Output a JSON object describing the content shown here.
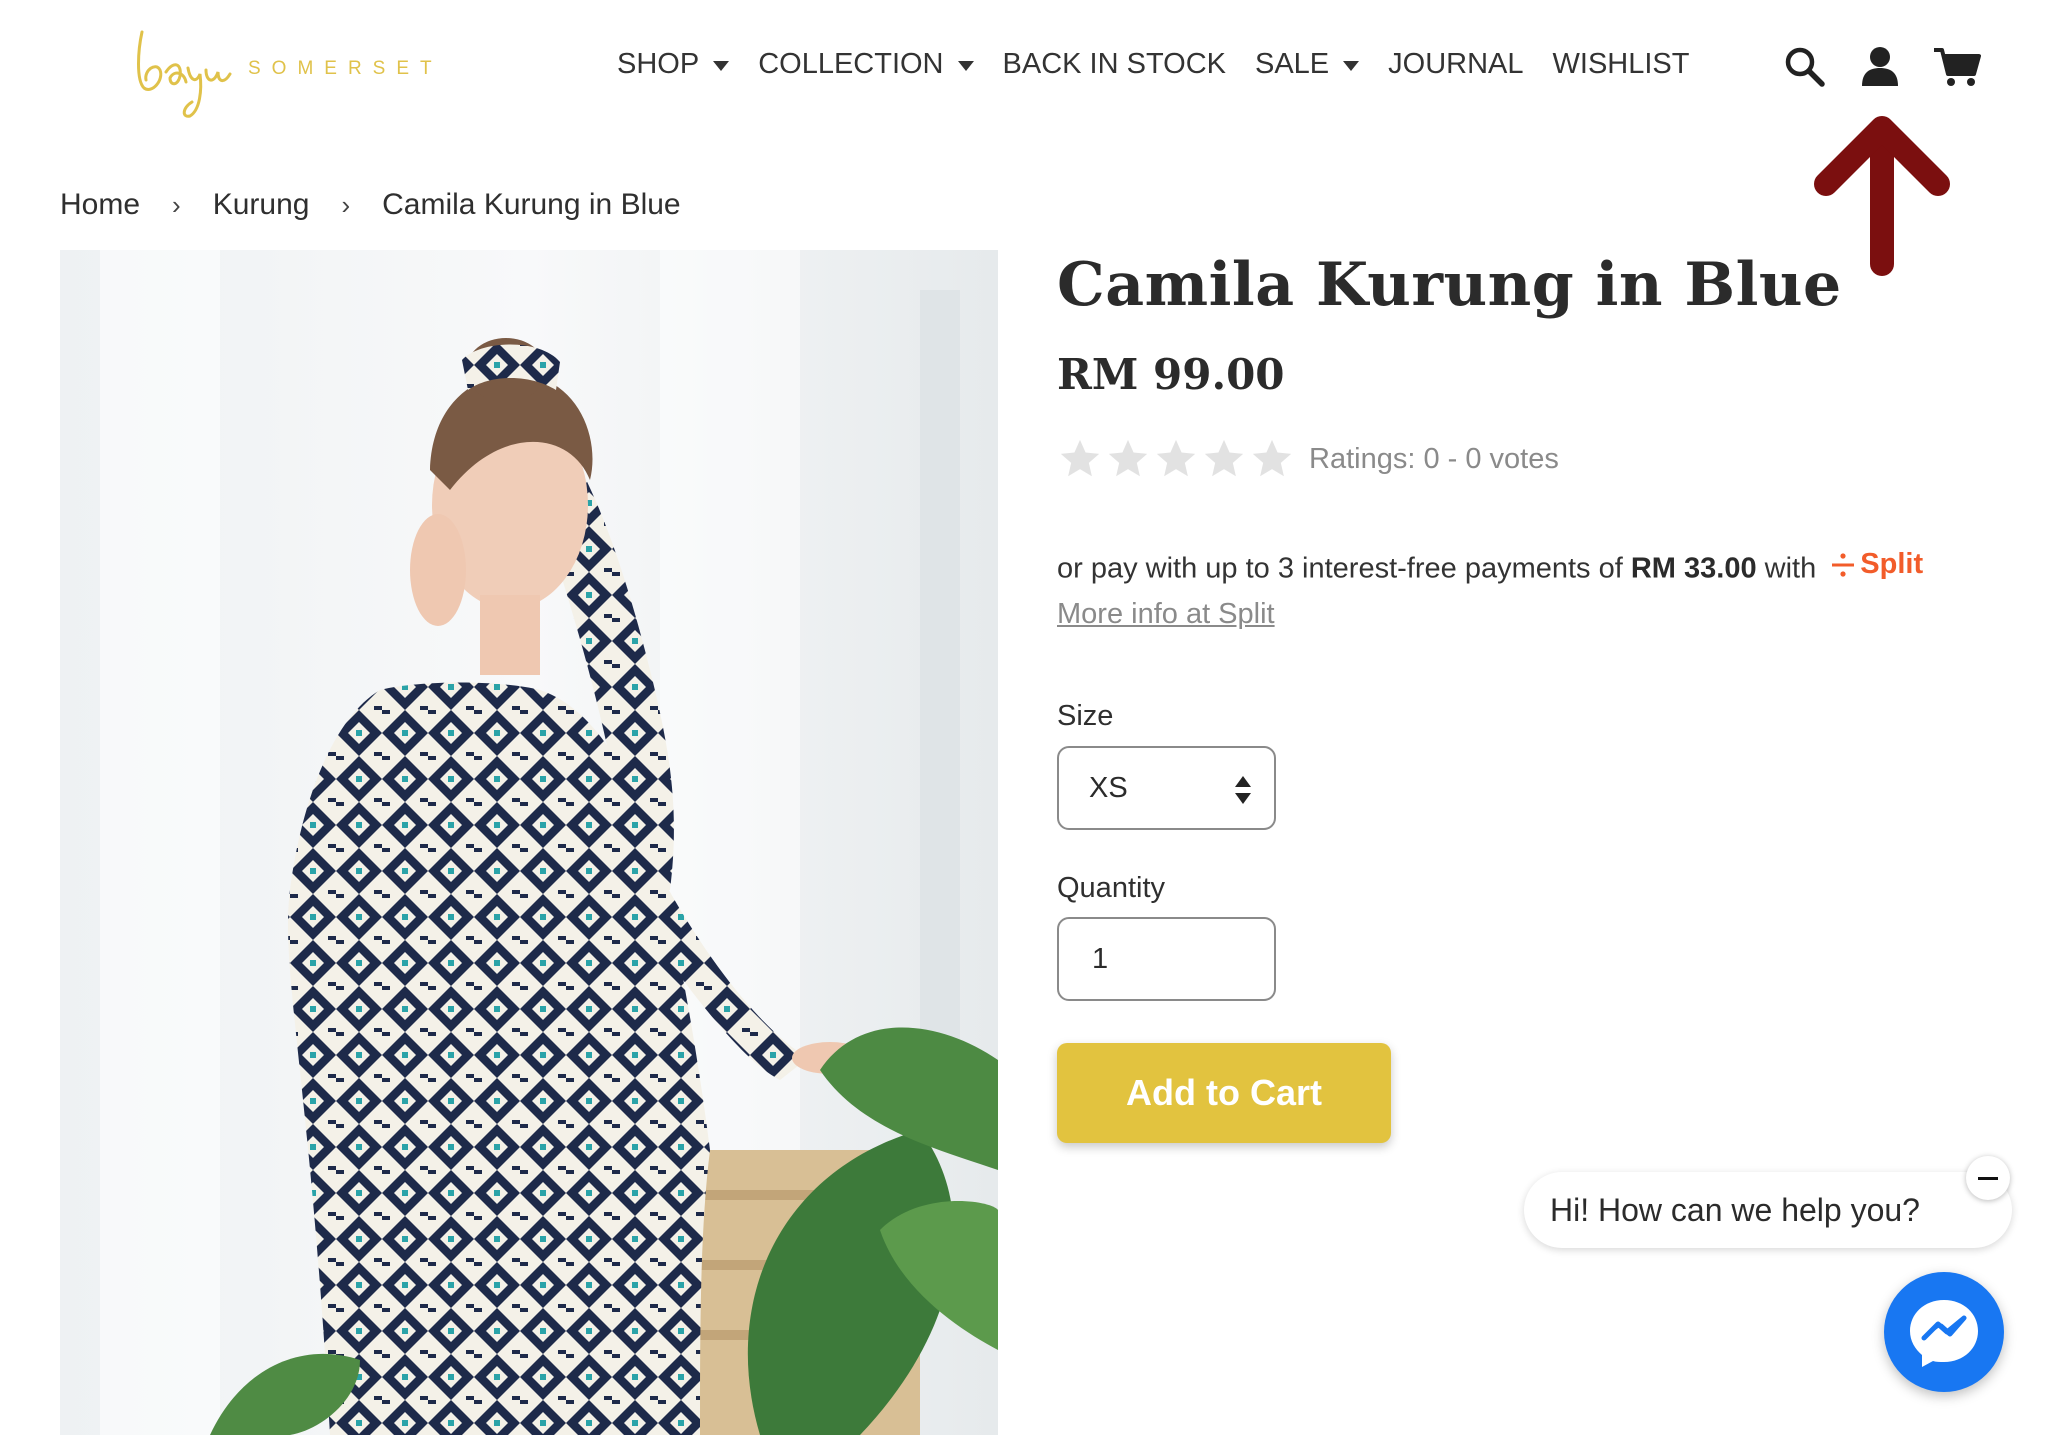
{
  "brand": {
    "script": "bayu",
    "wordmark": "SOMERSET",
    "color": "#e0c24a"
  },
  "nav": {
    "items": [
      {
        "label": "SHOP",
        "has_dropdown": true
      },
      {
        "label": "COLLECTION",
        "has_dropdown": true
      },
      {
        "label": "BACK IN STOCK",
        "has_dropdown": false
      },
      {
        "label": "SALE",
        "has_dropdown": true
      },
      {
        "label": "JOURNAL",
        "has_dropdown": false
      },
      {
        "label": "WISHLIST",
        "has_dropdown": false
      }
    ]
  },
  "header_icons": [
    "search-icon",
    "account-icon",
    "cart-icon"
  ],
  "annotation": {
    "icon": "red-arrow-up-icon",
    "color": "#7b0f0f"
  },
  "breadcrumb": {
    "items": [
      "Home",
      "Kurung",
      "Camila Kurung in Blue"
    ],
    "separator": "›"
  },
  "product": {
    "title": "Camila Kurung in Blue",
    "price": "RM 99.00",
    "rating_text": "Ratings: 0 - 0 votes",
    "stars_filled": 0,
    "stars_total": 5,
    "split": {
      "prefix": "or pay with up to 3 interest-free payments of",
      "amount": "RM 33.00",
      "suffix": "with",
      "brand": "Split",
      "brand_color": "#f25c2a",
      "link": "More info at Split "
    },
    "size_label": "Size",
    "size_value": "XS",
    "quantity_label": "Quantity",
    "quantity_value": "1",
    "add_to_cart": "Add to Cart",
    "button_color": "#e2c33f"
  },
  "chat": {
    "message": "Hi! How can we help you?",
    "icon": "messenger-icon",
    "color": "#1877f2"
  }
}
